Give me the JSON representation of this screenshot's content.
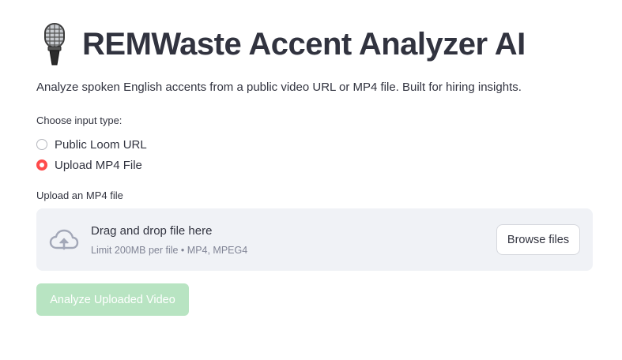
{
  "header": {
    "title": "REMWaste Accent Analyzer AI",
    "icon": "microphone-icon"
  },
  "subtitle": "Analyze spoken English accents from a public video URL or MP4 file. Built for hiring insights.",
  "input_type": {
    "label": "Choose input type:",
    "options": [
      {
        "label": "Public Loom URL",
        "selected": false
      },
      {
        "label": "Upload MP4 File",
        "selected": true
      }
    ]
  },
  "uploader": {
    "label": "Upload an MP4 file",
    "icon": "cloud-upload-icon",
    "drop_text": "Drag and drop file here",
    "limit_text": "Limit 200MB per file • MP4, MPEG4",
    "browse_label": "Browse files"
  },
  "actions": {
    "analyze_label": "Analyze Uploaded Video",
    "analyze_enabled": false
  },
  "colors": {
    "accent": "#ff4b4b",
    "dropzone_bg": "#f0f2f6",
    "disabled_button_bg": "#b8e4c2",
    "text": "#31333f"
  }
}
